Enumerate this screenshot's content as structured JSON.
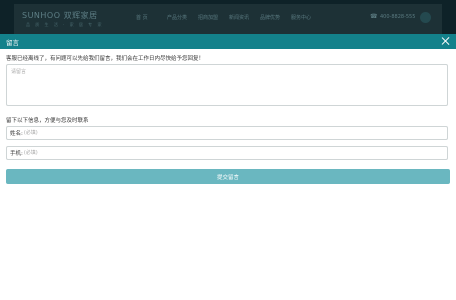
{
  "site": {
    "logo": "SUNHOO 双辉家居",
    "logo_sub": "品 质 生 活 · 家 居 专 家",
    "nav": [
      "首 页",
      "产品分类",
      "招商加盟",
      "新闻资讯",
      "品牌优势",
      "服务中心"
    ],
    "phone": "400-8828-555"
  },
  "modal": {
    "title": "留言",
    "intro": "客服已经离线了，有问题可以先给我们留言，我们会在工作日内尽快给予您回复！",
    "message_placeholder": "请留言",
    "contact_hint": "留下以下信息，方便与您及时联系",
    "name_label": "姓名:",
    "name_placeholder": "(必填)",
    "phone_label": "手机:",
    "phone_placeholder": "(必填)",
    "submit_label": "提交留言"
  }
}
